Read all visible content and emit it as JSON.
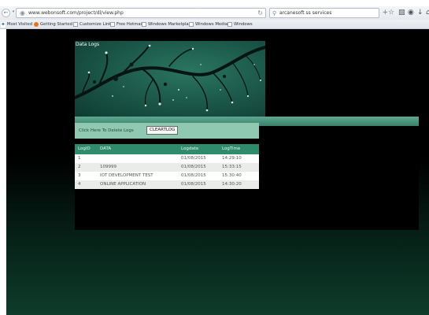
{
  "browser": {
    "url": "www.webonsoft.com/project/dl/view.php",
    "search_value": "arcanesoft ss services",
    "bookmarks": [
      "Most Visited",
      "Getting Started",
      "Customize Links",
      "Free Hotmail",
      "Windows Marketplace",
      "Windows Media",
      "Windows"
    ]
  },
  "page": {
    "banner_title": "Data Logs",
    "form_label": "Click Here To Delete Logs",
    "clear_button": "CLEARTLOG",
    "table": {
      "headers": [
        "LogID",
        "DATA",
        "Logdate",
        "LogTime"
      ],
      "rows": [
        [
          "1",
          "",
          "01/08/2015",
          "14:29:10"
        ],
        [
          "2",
          "109999",
          "01/08/2015",
          "15:33:15"
        ],
        [
          "3",
          "IOT DEVELOPMENT TEST",
          "01/08/2015",
          "15:30:40"
        ],
        [
          "4",
          "ONLINE APPLICATION",
          "01/08/2015",
          "14:30:20"
        ]
      ]
    }
  },
  "colors": {
    "header_row": "#2e8c6c",
    "form_bar": "#8fc9b2",
    "banner": "#1a5547"
  }
}
